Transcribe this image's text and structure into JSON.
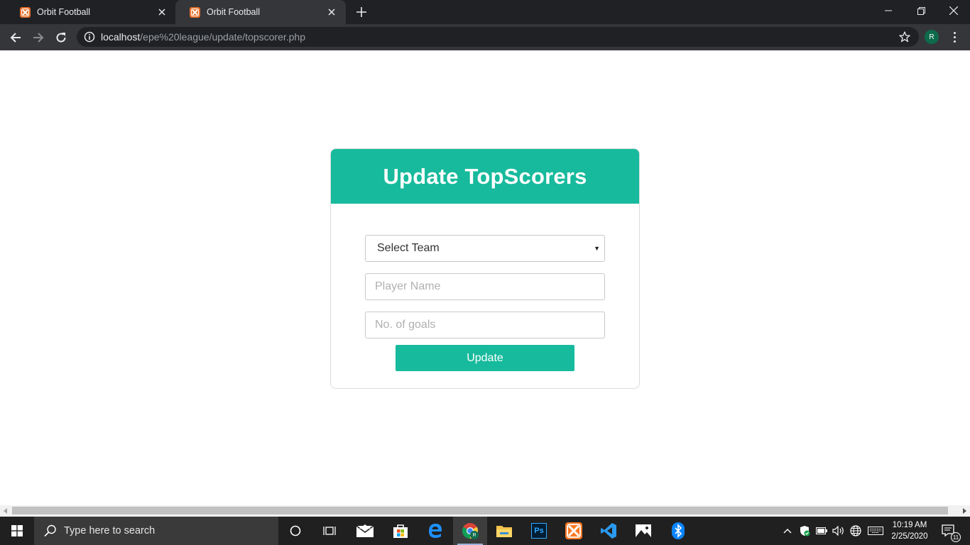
{
  "tabs": [
    {
      "title": "Orbit Football",
      "active": false
    },
    {
      "title": "Orbit Football",
      "active": true
    }
  ],
  "address_bar": {
    "host": "localhost",
    "path": "/epe%20league/update/topscorer.php"
  },
  "profile": {
    "initial": "R"
  },
  "form": {
    "heading": "Update TopScorers",
    "team_select": {
      "selected": "Select Team"
    },
    "player_name": {
      "placeholder": "Player Name"
    },
    "goals": {
      "placeholder": "No. of goals"
    },
    "submit_label": "Update"
  },
  "taskbar": {
    "search_placeholder": "Type here to search",
    "apps": [
      "cortana-icon",
      "task-view-icon",
      "mail-icon",
      "store-icon",
      "edge-icon",
      "chrome-icon",
      "file-explorer-icon",
      "photoshop-icon",
      "xampp-icon",
      "vscode-icon",
      "photos-icon",
      "bluetooth-icon"
    ],
    "chrome_badge": "R",
    "photoshop_label": "Ps",
    "clock": {
      "time": "10:19 AM",
      "date": "2/25/2020"
    },
    "notification_count": "11"
  },
  "colors": {
    "accent": "#17ba9c",
    "chrome_dark": "#202124",
    "chrome_toolbar": "#35363a",
    "taskbar": "#202020"
  }
}
